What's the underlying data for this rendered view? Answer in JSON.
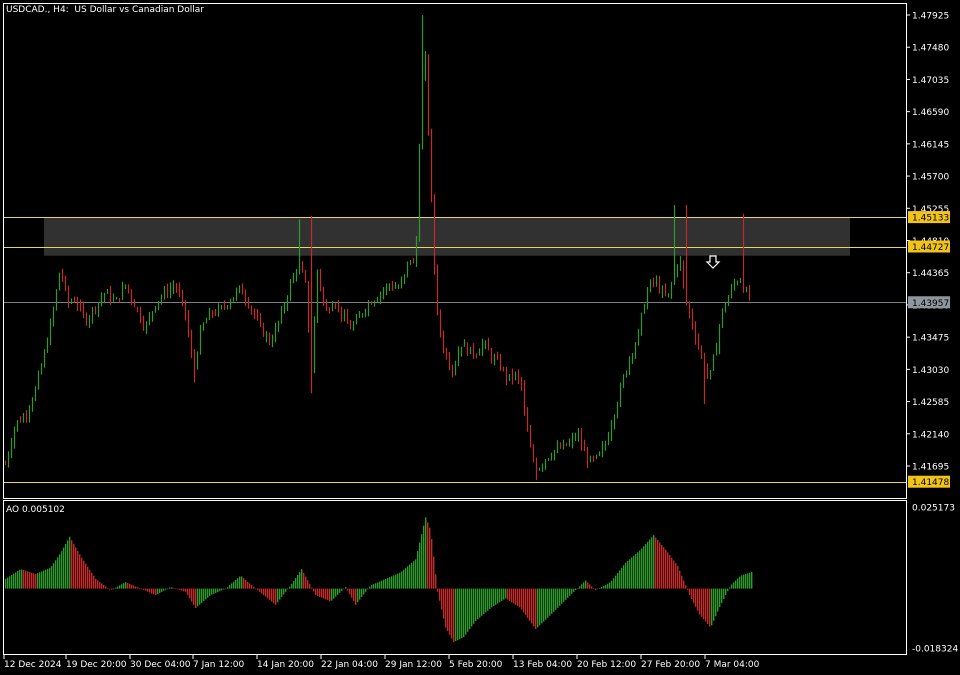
{
  "header": {
    "title": "USDCAD., H4:  US Dollar vs Canadian Dollar"
  },
  "colors": {
    "background": "#000000",
    "frame": "#ffffff",
    "bull": "#2e9a2e",
    "bear": "#c22b2b",
    "level": "#e8d85a",
    "current_line": "#7a7f86",
    "zone": "#3a3a3a",
    "tag_yellow": "#f2c417",
    "tag_grey": "#8f969e"
  },
  "main_axis": {
    "ticks": [
      "1.47925",
      "1.47480",
      "1.47035",
      "1.46590",
      "1.46145",
      "1.45700",
      "1.45255",
      "1.44810",
      "1.44365",
      "1.43920",
      "1.43475",
      "1.43030",
      "1.42585",
      "1.42140",
      "1.41695"
    ]
  },
  "price_tags": [
    {
      "name": "resistance-upper-tag",
      "text": "1.45133",
      "kind": "yellow"
    },
    {
      "name": "resistance-lower-tag",
      "text": "1.44727",
      "kind": "yellow"
    },
    {
      "name": "current-price-tag",
      "text": "1.43957",
      "kind": "grey"
    },
    {
      "name": "support-tag",
      "text": "1.41478",
      "kind": "yellow"
    }
  ],
  "ao_panel": {
    "label": "AO 0.005102",
    "max_label": "0.025173",
    "min_label": "-0.018324"
  },
  "time_axis": {
    "labels": [
      "12 Dec 2024",
      "19 Dec 20:00",
      "30 Dec 04:00",
      "7 Jan 12:00",
      "14 Jan 20:00",
      "22 Jan 04:00",
      "29 Jan 12:00",
      "5 Feb 20:00",
      "13 Feb 04:00",
      "20 Feb 12:00",
      "27 Feb 20:00",
      "7 Mar 04:00"
    ]
  },
  "chart_data": [
    {
      "type": "candlestick",
      "symbol": "USDCAD.",
      "timeframe": "H4",
      "title": "USDCAD., H4:  US Dollar vs Canadian Dollar",
      "y_axis_ticks": [
        1.47925,
        1.4748,
        1.47035,
        1.4659,
        1.46145,
        1.457,
        1.45255,
        1.4481,
        1.44365,
        1.4392,
        1.43475,
        1.4303,
        1.42585,
        1.4214,
        1.41695
      ],
      "x_axis_labels": [
        "12 Dec 2024",
        "19 Dec 20:00",
        "30 Dec 04:00",
        "7 Jan 12:00",
        "14 Jan 20:00",
        "22 Jan 04:00",
        "29 Jan 12:00",
        "5 Feb 20:00",
        "13 Feb 04:00",
        "20 Feb 12:00",
        "27 Feb 20:00",
        "7 Mar 04:00"
      ],
      "horizontal_levels": [
        {
          "value": 1.45133,
          "style": "yellow"
        },
        {
          "value": 1.44727,
          "style": "yellow"
        },
        {
          "value": 1.43957,
          "style": "current-price"
        },
        {
          "value": 1.41478,
          "style": "yellow"
        }
      ],
      "zone": {
        "from": 1.446,
        "to": 1.45133
      },
      "close_path": [
        [
          0,
          1.4172
        ],
        [
          10,
          1.4228
        ],
        [
          20,
          1.424
        ],
        [
          30,
          1.4275
        ],
        [
          40,
          1.433
        ],
        [
          48,
          1.4385
        ],
        [
          55,
          1.4445
        ],
        [
          62,
          1.4395
        ],
        [
          70,
          1.44
        ],
        [
          80,
          1.437
        ],
        [
          90,
          1.439
        ],
        [
          100,
          1.441
        ],
        [
          110,
          1.4395
        ],
        [
          120,
          1.442
        ],
        [
          130,
          1.439
        ],
        [
          140,
          1.436
        ],
        [
          150,
          1.4395
        ],
        [
          160,
          1.441
        ],
        [
          170,
          1.442
        ],
        [
          180,
          1.438
        ],
        [
          188,
          1.43
        ],
        [
          196,
          1.436
        ],
        [
          205,
          1.438
        ],
        [
          215,
          1.4385
        ],
        [
          225,
          1.44
        ],
        [
          235,
          1.4415
        ],
        [
          245,
          1.439
        ],
        [
          255,
          1.436
        ],
        [
          265,
          1.434
        ],
        [
          275,
          1.4375
        ],
        [
          285,
          1.442
        ],
        [
          293,
          1.445
        ],
        [
          300,
          1.442
        ],
        [
          306,
          1.43
        ],
        [
          312,
          1.444
        ],
        [
          320,
          1.438
        ],
        [
          328,
          1.44
        ],
        [
          336,
          1.438
        ],
        [
          344,
          1.436
        ],
        [
          352,
          1.437
        ],
        [
          360,
          1.439
        ],
        [
          368,
          1.44
        ],
        [
          376,
          1.441
        ],
        [
          384,
          1.442
        ],
        [
          392,
          1.4415
        ],
        [
          398,
          1.4425
        ],
        [
          404,
          1.446
        ],
        [
          410,
          1.444
        ],
        [
          416,
          1.47
        ],
        [
          420,
          1.473
        ],
        [
          424,
          1.46
        ],
        [
          430,
          1.441
        ],
        [
          436,
          1.434
        ],
        [
          442,
          1.432
        ],
        [
          448,
          1.43
        ],
        [
          455,
          1.434
        ],
        [
          462,
          1.433
        ],
        [
          470,
          1.4325
        ],
        [
          478,
          1.434
        ],
        [
          486,
          1.432
        ],
        [
          494,
          1.431
        ],
        [
          502,
          1.429
        ],
        [
          510,
          1.4295
        ],
        [
          516,
          1.428
        ],
        [
          520,
          1.423
        ],
        [
          526,
          1.4185
        ],
        [
          532,
          1.4165
        ],
        [
          540,
          1.418
        ],
        [
          548,
          1.419
        ],
        [
          556,
          1.4195
        ],
        [
          564,
          1.42
        ],
        [
          572,
          1.4215
        ],
        [
          578,
          1.419
        ],
        [
          584,
          1.4175
        ],
        [
          592,
          1.418
        ],
        [
          600,
          1.42
        ],
        [
          608,
          1.424
        ],
        [
          616,
          1.428
        ],
        [
          624,
          1.432
        ],
        [
          632,
          1.4345
        ],
        [
          638,
          1.439
        ],
        [
          644,
          1.442
        ],
        [
          650,
          1.4425
        ],
        [
          656,
          1.441
        ],
        [
          662,
          1.44
        ],
        [
          668,
          1.443
        ],
        [
          674,
          1.446
        ],
        [
          680,
          1.44
        ],
        [
          686,
          1.437
        ],
        [
          692,
          1.434
        ],
        [
          698,
          1.431
        ],
        [
          704,
          1.429
        ],
        [
          710,
          1.433
        ],
        [
          716,
          1.438
        ],
        [
          722,
          1.44
        ],
        [
          728,
          1.442
        ],
        [
          734,
          1.443
        ],
        [
          740,
          1.441
        ],
        [
          746,
          1.4396
        ]
      ],
      "spike_highs": [
        [
          293,
          1.451
        ],
        [
          306,
          1.4515
        ],
        [
          416,
          1.47925
        ],
        [
          424,
          1.469
        ],
        [
          668,
          1.453
        ],
        [
          680,
          1.453
        ],
        [
          738,
          1.4518
        ]
      ],
      "spike_lows": [
        [
          188,
          1.4285
        ],
        [
          306,
          1.427
        ],
        [
          532,
          1.415
        ],
        [
          698,
          1.4255
        ],
        [
          746,
          1.4365
        ]
      ]
    },
    {
      "type": "bar",
      "indicator": "AO",
      "label": "AO 0.005102",
      "last_value": 0.005102,
      "ylim": [
        -0.018324,
        0.025173
      ],
      "profile": [
        [
          0,
          0.003
        ],
        [
          15,
          0.006
        ],
        [
          30,
          0.0045
        ],
        [
          45,
          0.0065
        ],
        [
          55,
          0.011
        ],
        [
          64,
          0.016
        ],
        [
          75,
          0.01
        ],
        [
          90,
          0.003
        ],
        [
          105,
          -0.0005
        ],
        [
          120,
          0.002
        ],
        [
          135,
          0.0
        ],
        [
          150,
          -0.002
        ],
        [
          165,
          0.0005
        ],
        [
          180,
          -0.001
        ],
        [
          190,
          -0.006
        ],
        [
          205,
          -0.002
        ],
        [
          220,
          0.0
        ],
        [
          235,
          0.004
        ],
        [
          250,
          0.0
        ],
        [
          270,
          -0.005
        ],
        [
          285,
          0.001
        ],
        [
          296,
          0.006
        ],
        [
          310,
          -0.002
        ],
        [
          325,
          -0.004
        ],
        [
          340,
          0.0005
        ],
        [
          350,
          -0.005
        ],
        [
          365,
          0.001
        ],
        [
          380,
          0.003
        ],
        [
          395,
          0.005
        ],
        [
          410,
          0.009
        ],
        [
          420,
          0.022
        ],
        [
          425,
          0.018
        ],
        [
          432,
          -0.001
        ],
        [
          440,
          -0.012
        ],
        [
          448,
          -0.0165
        ],
        [
          458,
          -0.015
        ],
        [
          470,
          -0.01
        ],
        [
          485,
          -0.006
        ],
        [
          500,
          -0.003
        ],
        [
          515,
          -0.006
        ],
        [
          530,
          -0.0125
        ],
        [
          542,
          -0.009
        ],
        [
          555,
          -0.005
        ],
        [
          568,
          -0.001
        ],
        [
          580,
          0.0025
        ],
        [
          590,
          -0.0005
        ],
        [
          605,
          0.002
        ],
        [
          620,
          0.008
        ],
        [
          635,
          0.012
        ],
        [
          648,
          0.0165
        ],
        [
          660,
          0.012
        ],
        [
          672,
          0.007
        ],
        [
          684,
          -0.002
        ],
        [
          694,
          -0.008
        ],
        [
          705,
          -0.012
        ],
        [
          715,
          -0.005
        ],
        [
          725,
          0.001
        ],
        [
          735,
          0.004
        ],
        [
          746,
          0.0051
        ]
      ]
    }
  ]
}
